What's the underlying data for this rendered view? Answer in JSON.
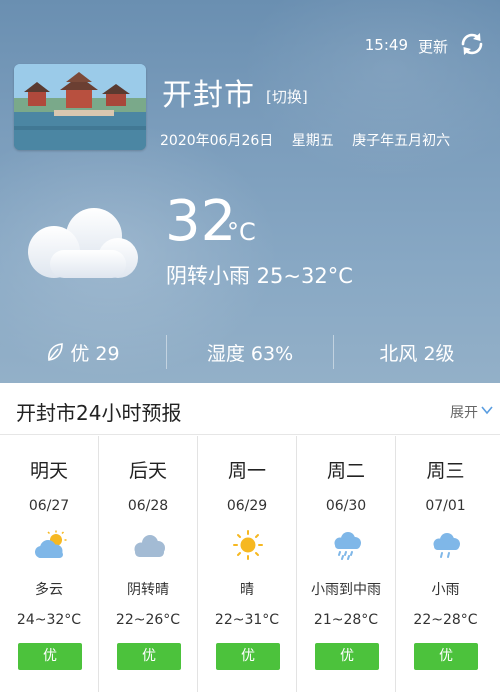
{
  "header": {
    "time": "15:49",
    "refresh_label": "更新",
    "city": "开封市",
    "switch_label": "[切换]",
    "date": "2020年06月26日",
    "weekday": "星期五",
    "lunar_date": "庚子年五月初六"
  },
  "current": {
    "temperature": "32",
    "unit": "°C",
    "condition": "阴转小雨 25~32°C",
    "icon": "cloud-icon"
  },
  "stats": {
    "aqi": "优 29",
    "humidity": "湿度 63%",
    "wind": "北风 2级"
  },
  "forecast": {
    "title": "开封市24小时预报",
    "expand_label": "展开",
    "days": [
      {
        "name": "明天",
        "date": "06/27",
        "icon": "partly-cloudy-icon",
        "condition": "多云",
        "temp": "24~32°C",
        "aqi": "优"
      },
      {
        "name": "后天",
        "date": "06/28",
        "icon": "cloudy-icon",
        "condition": "阴转晴",
        "temp": "22~26°C",
        "aqi": "优"
      },
      {
        "name": "周一",
        "date": "06/29",
        "icon": "sunny-icon",
        "condition": "晴",
        "temp": "22~31°C",
        "aqi": "优"
      },
      {
        "name": "周二",
        "date": "06/30",
        "icon": "rain-icon",
        "condition": "小雨到中雨",
        "temp": "21~28°C",
        "aqi": "优"
      },
      {
        "name": "周三",
        "date": "07/01",
        "icon": "light-rain-icon",
        "condition": "小雨",
        "temp": "22~28°C",
        "aqi": "优"
      }
    ]
  },
  "colors": {
    "sky": "#7b9dbc",
    "aqi_good": "#4cc23c",
    "icon_blue": "#7fb7e8",
    "sun": "#f6b821"
  }
}
